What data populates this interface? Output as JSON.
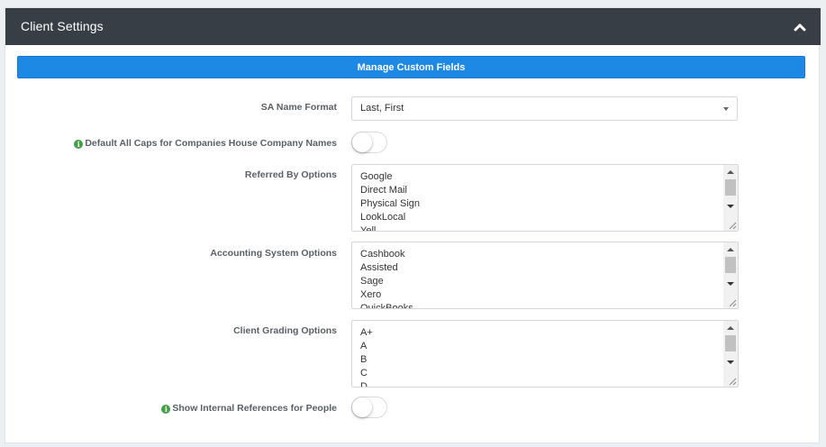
{
  "panel": {
    "title": "Client Settings",
    "collapse_icon": "chevron-up-icon"
  },
  "manage_custom_fields_label": "Manage Custom Fields",
  "fields": {
    "sa_name_format": {
      "label": "SA Name Format",
      "value": "Last, First"
    },
    "default_all_caps": {
      "label": "Default All Caps for Companies House Company Names",
      "enabled": false
    },
    "referred_by": {
      "label": "Referred By Options",
      "lines": [
        "Google",
        "Direct Mail",
        "Physical Sign",
        "LookLocal",
        "Yell"
      ]
    },
    "accounting_system": {
      "label": "Accounting System Options",
      "lines": [
        "Cashbook",
        "Assisted",
        "Sage",
        "Xero",
        "QuickBooks"
      ]
    },
    "client_grading": {
      "label": "Client Grading Options",
      "lines": [
        "A+",
        "A",
        "B",
        "C",
        "D"
      ]
    },
    "show_internal_refs": {
      "label": "Show Internal References for People",
      "enabled": false
    }
  },
  "colors": {
    "header_bg": "#383e46",
    "primary_button": "#1e88e5",
    "info_icon": "#43a047"
  }
}
